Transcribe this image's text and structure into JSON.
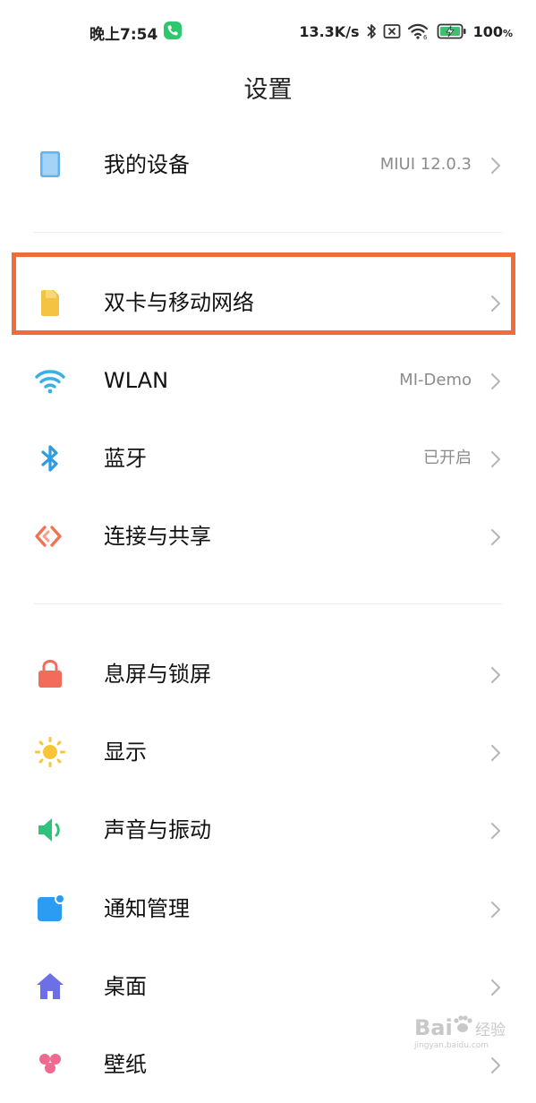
{
  "status_bar": {
    "time": "晚上7:54",
    "net_speed": "13.3K/s",
    "battery_percent": "100",
    "battery_unit": "%",
    "icons": [
      "phone-call-icon",
      "bluetooth-icon",
      "sim-off-icon",
      "wifi-icon",
      "battery-charging-icon"
    ]
  },
  "header": {
    "title": "设置"
  },
  "colors": {
    "highlight": "#f06c3a",
    "sim": "#f5c342",
    "wifi": "#3ab0e2",
    "bluetooth": "#2e9de0",
    "share": "#f07354",
    "lock": "#f26b5b",
    "display": "#f8c537",
    "sound": "#2fc27a",
    "notify": "#2b9cf2",
    "desktop": "#6c6fe6"
  },
  "settings": {
    "my_device": {
      "label": "我的设备",
      "value": "MIUI 12.0.3",
      "icon": "device-icon"
    },
    "sim": {
      "label": "双卡与移动网络",
      "icon": "sim-card-icon"
    },
    "wlan": {
      "label": "WLAN",
      "value": "MI-Demo",
      "icon": "wifi-icon"
    },
    "bluetooth": {
      "label": "蓝牙",
      "value": "已开启",
      "icon": "bluetooth-icon"
    },
    "share": {
      "label": "连接与共享",
      "icon": "share-icon"
    },
    "lock": {
      "label": "息屏与锁屏",
      "icon": "lock-icon"
    },
    "display": {
      "label": "显示",
      "icon": "sun-icon"
    },
    "sound": {
      "label": "声音与振动",
      "icon": "speaker-icon"
    },
    "notify": {
      "label": "通知管理",
      "icon": "notification-icon"
    },
    "desktop": {
      "label": "桌面",
      "icon": "home-icon"
    },
    "wallpaper": {
      "label": "壁纸",
      "icon": "wallpaper-icon"
    }
  },
  "watermark": {
    "brand": "Bai",
    "subtitle": "jingyan.baidu.com",
    "icon": "paw-icon"
  }
}
